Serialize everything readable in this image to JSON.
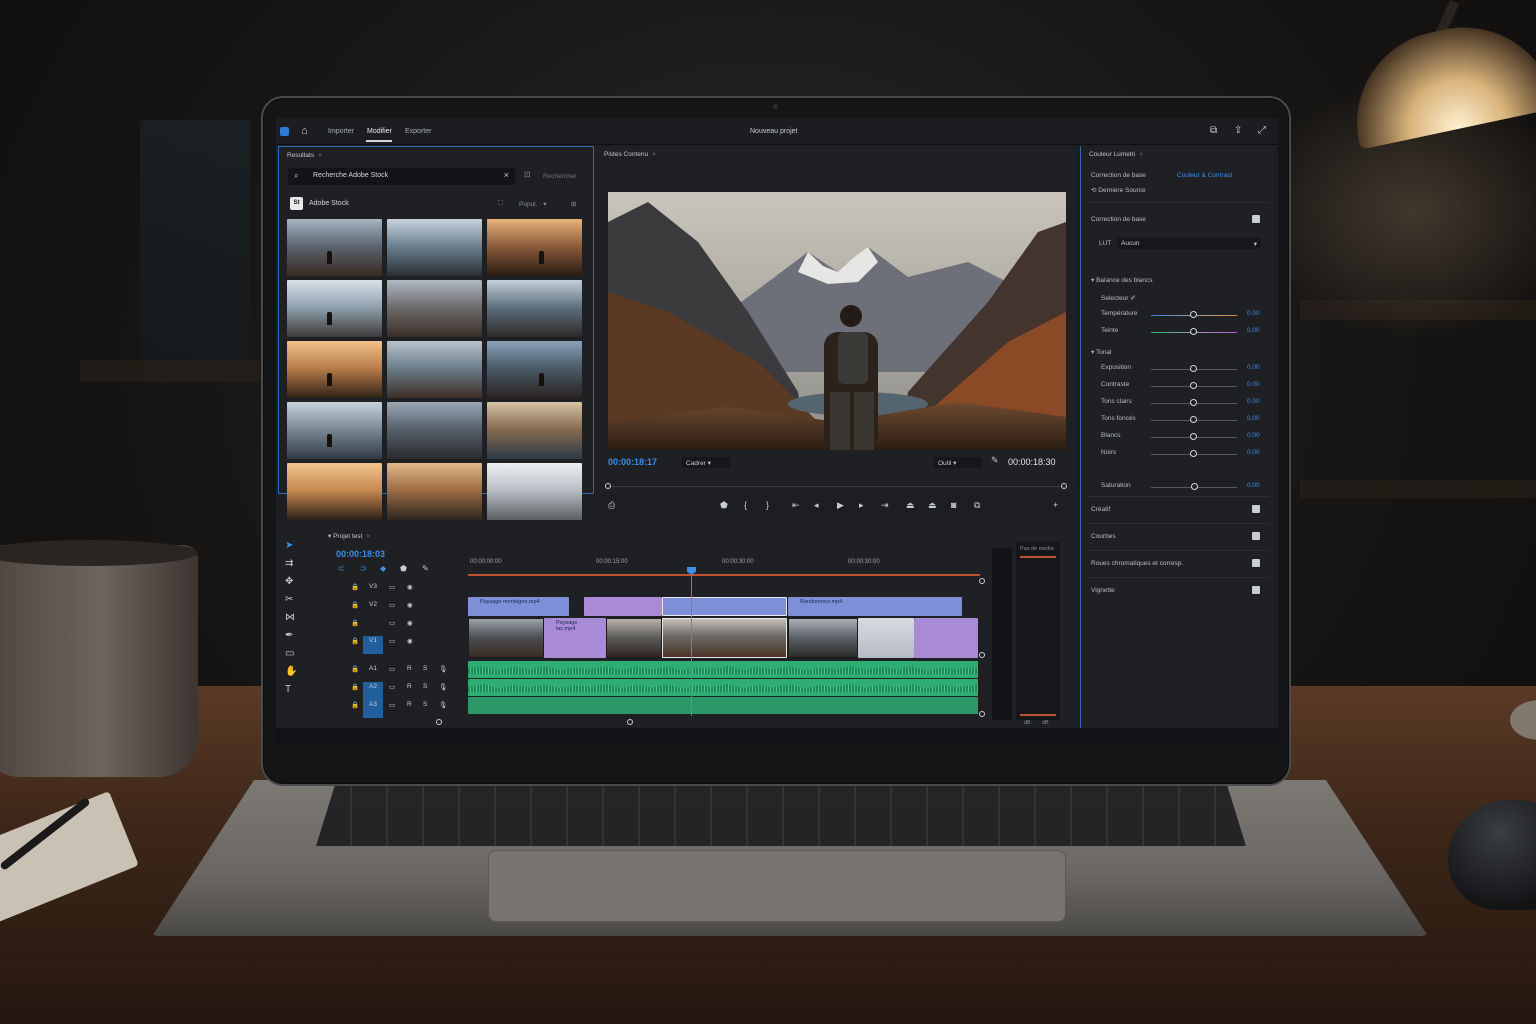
{
  "app": {
    "nav": [
      "Importer",
      "Modifier",
      "Exporter"
    ],
    "active_nav": "Modifier",
    "project_title": "Nouveau projet"
  },
  "left_panel": {
    "title": "Resultats",
    "search": {
      "value": "Recherche Adobe Stock",
      "refine": "Rechercher"
    },
    "source": "Adobe Stock",
    "source_logo": "St",
    "sort": "Popul.  ·  ▾",
    "thumbnail_count": 15
  },
  "monitor": {
    "title": "Pistes Contenu",
    "timecode_current": "00:00:18:17",
    "fit": "Cadrer",
    "quality": "Outil",
    "timecode_duration": "00:00:18:30"
  },
  "lumetri": {
    "title": "Couleur Lumetri",
    "tab1": "Correction de base",
    "tab2": "Couleur & Contrast",
    "preset": "Derniere Source",
    "sections": {
      "basic": "Correction de base",
      "lut_label": "LUT",
      "lut_value": "Aucun",
      "white_balance": "Balance des blancs",
      "wb_selector": "Selecteur",
      "tone": "Tonal",
      "saturation": "Saturation",
      "creative": "Créatif",
      "curves": "Courbes",
      "wheels": "Roues chromatiques et corresp.",
      "vignette": "Vignette"
    },
    "sliders": [
      {
        "label": "Température",
        "value": "0.00",
        "level": 0.5
      },
      {
        "label": "Teinte",
        "value": "0.00",
        "level": 0.5
      },
      {
        "label": "Exposition",
        "value": "0.00",
        "level": 0.5
      },
      {
        "label": "Contraste",
        "value": "0.00",
        "level": 0.5
      },
      {
        "label": "Tons clairs",
        "value": "0.00",
        "level": 0.5
      },
      {
        "label": "Tons foncés",
        "value": "0.00",
        "level": 0.5
      },
      {
        "label": "Blancs",
        "value": "0.00",
        "level": 0.5
      },
      {
        "label": "Noirs",
        "value": "0.00",
        "level": 0.5
      }
    ],
    "saturation_value": "0.00"
  },
  "timeline": {
    "title": "Projet test",
    "timecode": "00:00:18:03",
    "ruler": [
      "00:00:00:00",
      "00:00:15:00",
      "00:00:30:00",
      "00:00:30:00"
    ],
    "tracks": [
      {
        "name": "V3",
        "num": "V3"
      },
      {
        "name": "V2",
        "num": "V2"
      },
      {
        "name": "V1",
        "num": "V1"
      },
      {
        "name": "A1",
        "num": "A1"
      },
      {
        "name": "A2",
        "num": "A2"
      },
      {
        "name": "A3",
        "num": "A3"
      }
    ],
    "clips_v2": [
      "Paysage montagne.mp4",
      "Randonneur.mp4"
    ],
    "clip_v1": "Paysage lac.mp4",
    "meter_labels": [
      "dB",
      "dB"
    ],
    "meter_top": "Pas de media"
  },
  "colors": {
    "accent": "#3b8fe6",
    "video_clip": "#7e8fd8",
    "purple_clip": "#a98ad6",
    "audio_clip": "#2fae74",
    "ruler": "#c0532f"
  }
}
